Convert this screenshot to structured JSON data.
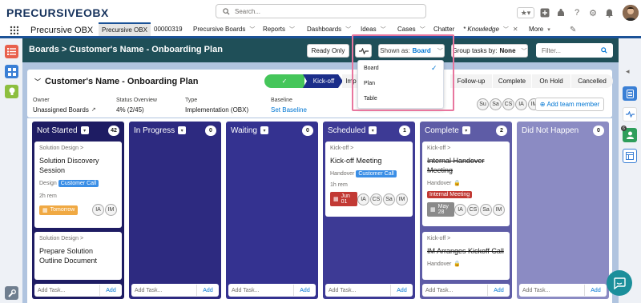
{
  "brand": {
    "logo_text_left": "PRECURSIVE",
    "logo_text_right": "OBX"
  },
  "search": {
    "placeholder": "Search..."
  },
  "nav": {
    "app_name": "Precursive OBX",
    "tabs": [
      {
        "label": "Precursive OBX",
        "active": true,
        "chevron": false
      },
      {
        "label": "00000319",
        "chevron": false
      },
      {
        "label": "Precursive Boards",
        "chevron": true
      },
      {
        "label": "Reports",
        "chevron": true
      },
      {
        "label": "Dashboards",
        "chevron": true
      },
      {
        "label": "Ideas",
        "chevron": true
      },
      {
        "label": "Cases",
        "chevron": true
      },
      {
        "label": "Chatter",
        "chevron": false
      },
      {
        "label": "* Knowledge",
        "chevron": true
      },
      {
        "label": "More",
        "chevron": true
      }
    ]
  },
  "page_header": {
    "breadcrumb": "Boards > Customer's Name - Onboarding Plan",
    "ready_only": "Ready Only",
    "shown_as_label": "Shown as:",
    "shown_as_value": "Board",
    "group_label": "Group tasks by:",
    "group_value": "None",
    "filter_placeholder": "Filter..."
  },
  "record": {
    "title": "Customer's Name - Onboarding Plan",
    "owner_label": "Owner",
    "owner_value": "Unassigned Boards",
    "status_label": "Status Overview",
    "status_value": "4% (2/45)",
    "type_label": "Type",
    "type_value": "Implementation (OBX)",
    "baseline_label": "Baseline",
    "baseline_value": "Set Baseline",
    "add_team": "Add team member",
    "team": [
      "Su",
      "Sa",
      "CS",
      "IA",
      "IM"
    ]
  },
  "path": [
    "Kick-off",
    "Imp",
    "Follow-up",
    "Complete",
    "On Hold",
    "Cancelled"
  ],
  "dropdown": {
    "items": [
      "Board",
      "Plan",
      "Table"
    ],
    "selected": "Board"
  },
  "columns": [
    {
      "name": "Not Started",
      "count": "42",
      "color": "#1e1c63"
    },
    {
      "name": "In Progress",
      "count": "0",
      "color": "#2d2a80"
    },
    {
      "name": "Waiting",
      "count": "0",
      "color": "#343290"
    },
    {
      "name": "Scheduled",
      "count": "1",
      "color": "#3d3a95"
    },
    {
      "name": "Complete",
      "count": "2",
      "color": "#5e5ca6"
    },
    {
      "name": "Did Not Happen",
      "count": "0",
      "color": "#8b8bc3"
    }
  ],
  "cards": {
    "c1": {
      "sub": "Solution Design >",
      "title": "Solution Discovery Session",
      "type": "Design",
      "tag": "Customer Call",
      "rem": "2h rem",
      "date": "Tomorrow",
      "avatars": [
        "IA",
        "IM"
      ]
    },
    "c2": {
      "sub": "Solution Design >",
      "title": "Prepare Solution Outline Document"
    },
    "c3": {
      "sub": "Kick-off >",
      "title": "Kick-off Meeting",
      "type": "Handover",
      "tag": "Customer Call",
      "rem": "1h rem",
      "date": "Jun 01",
      "avatars": [
        "IA",
        "CS",
        "Sa",
        "IM"
      ]
    },
    "c4": {
      "sub": "Kick-off >",
      "title": "Internal Handover Meeting",
      "type": "Handover",
      "tag": "Internal Meeting",
      "date": "May 28",
      "avatars": [
        "IA",
        "CS",
        "Sa",
        "IM"
      ]
    },
    "c5": {
      "sub": "Kick-off >",
      "title": "IM Arranges Kickoff Call",
      "type": "Handover"
    }
  },
  "add_task": {
    "placeholder": "Add Task...",
    "button": "Add"
  }
}
